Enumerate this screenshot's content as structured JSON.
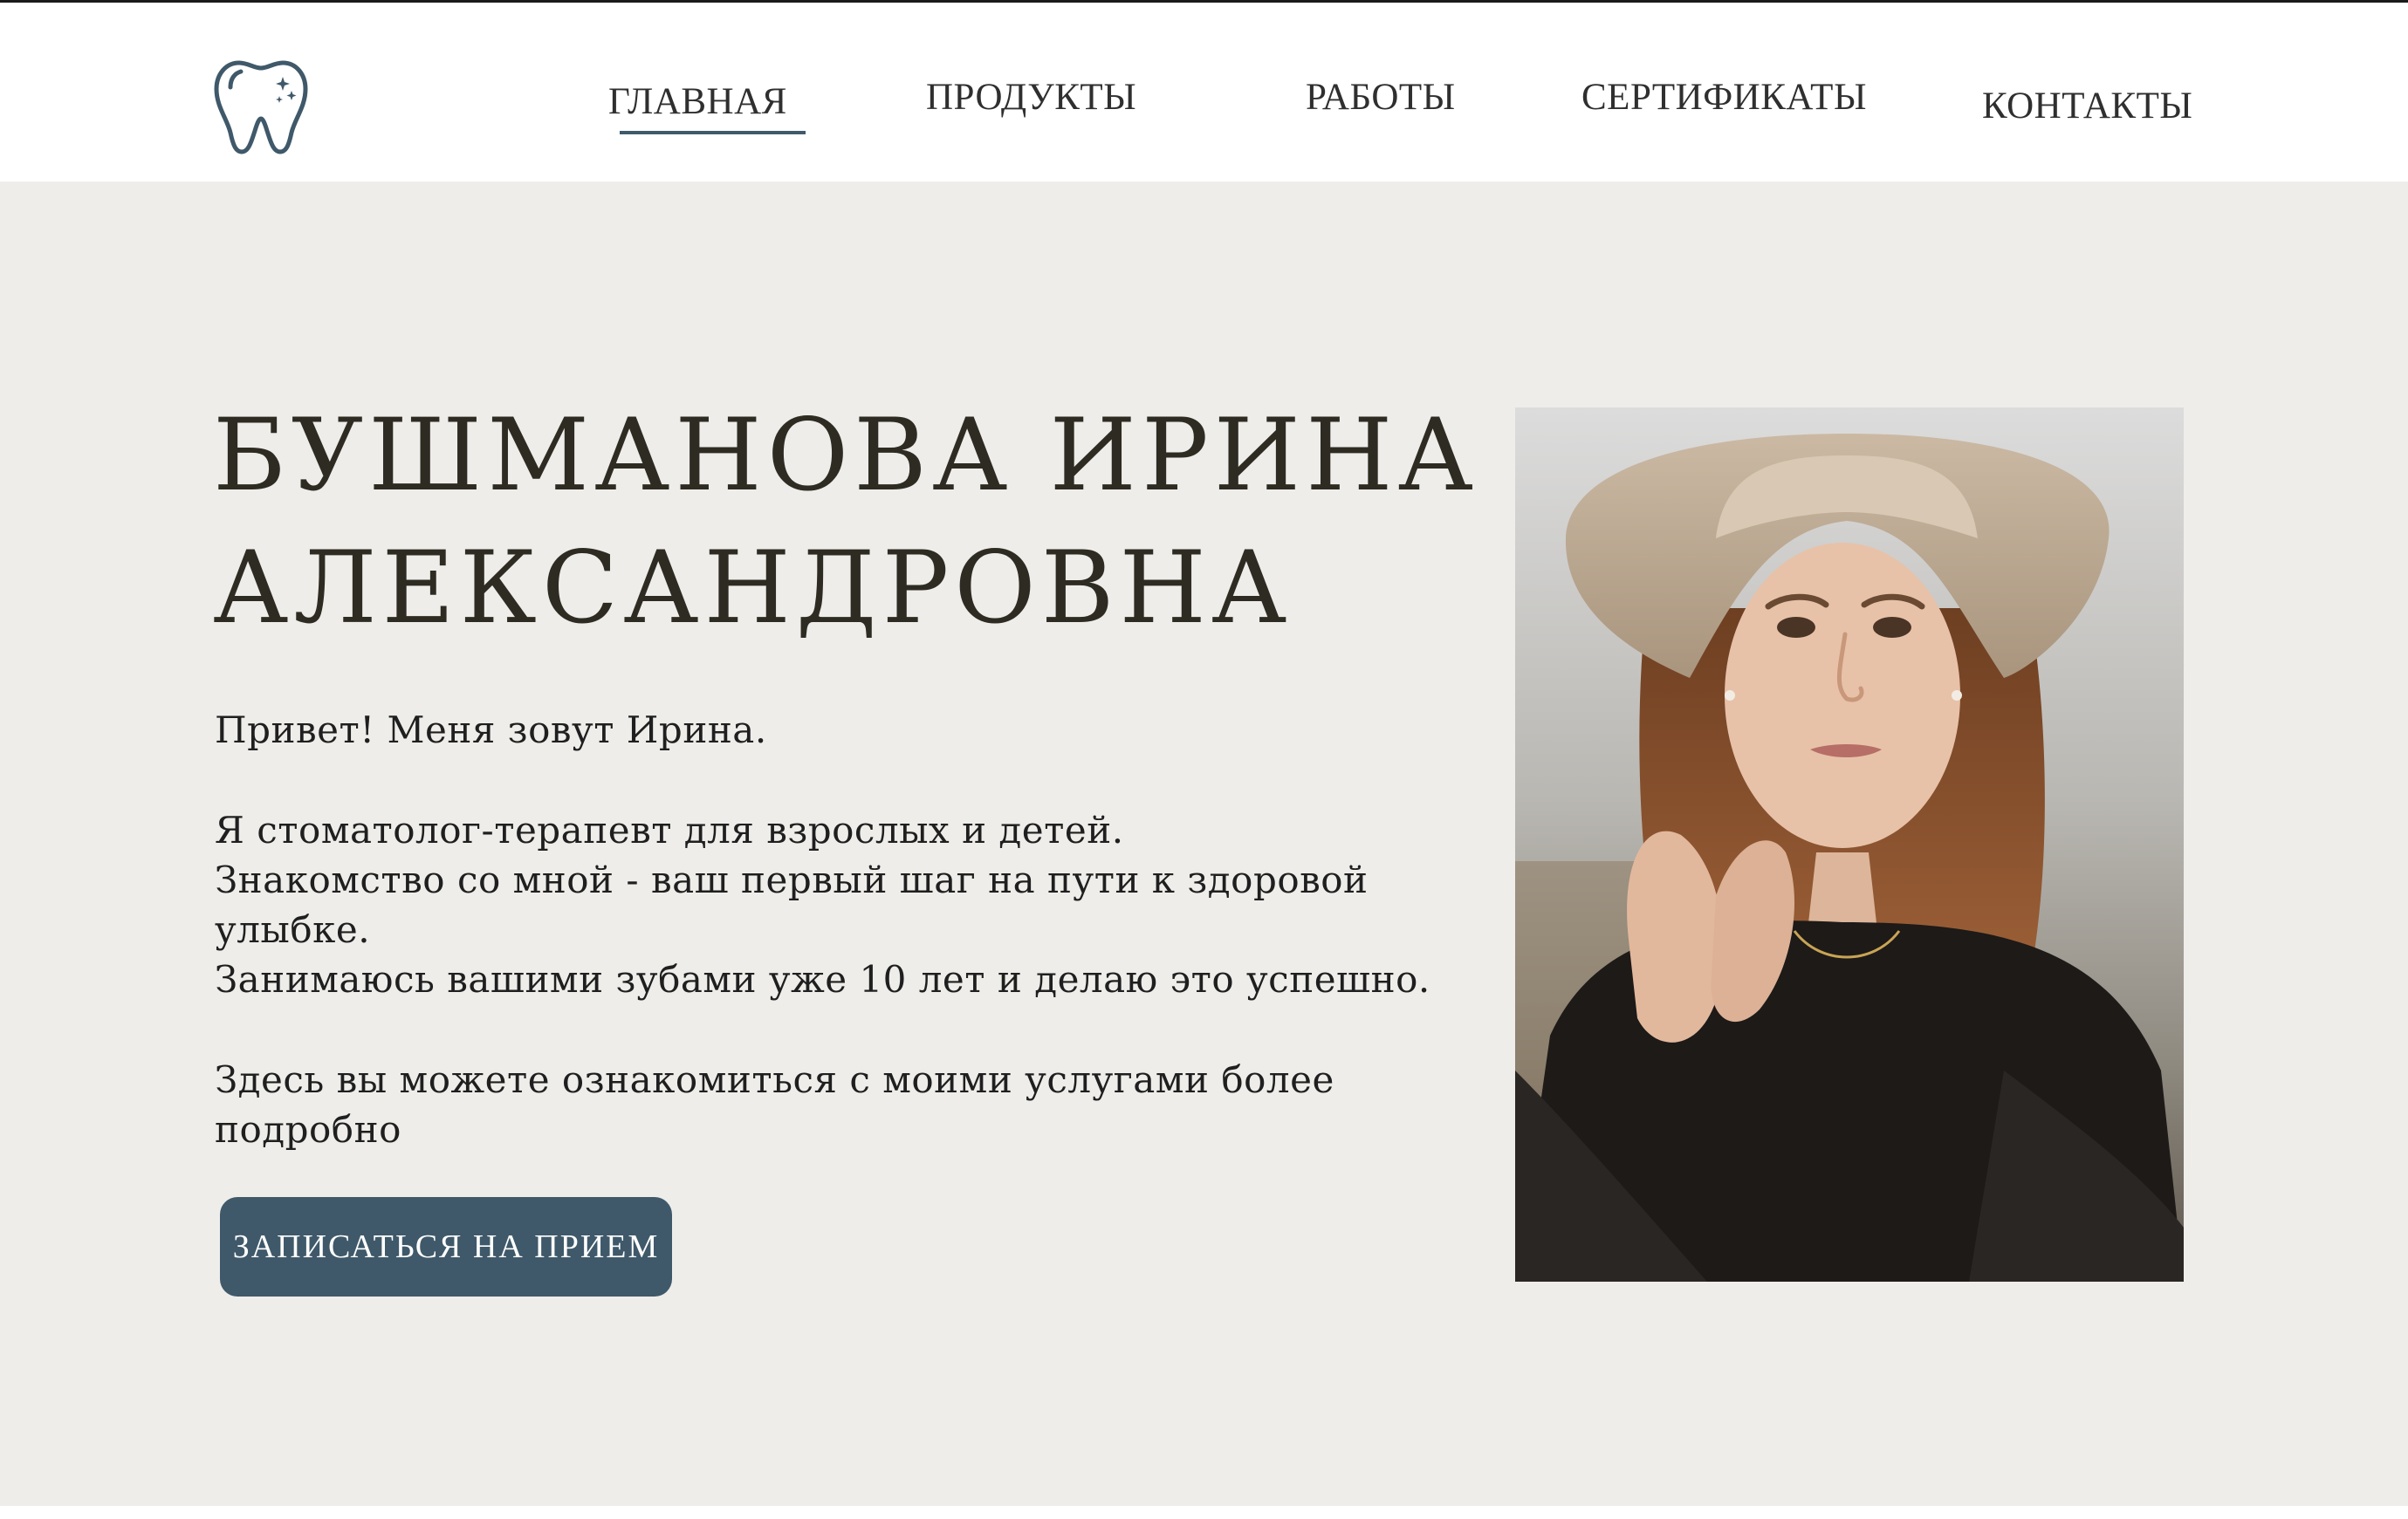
{
  "nav": {
    "items": [
      {
        "label": "ГЛАВНАЯ",
        "active": true
      },
      {
        "label": "ПРОДУКТЫ",
        "active": false
      },
      {
        "label": "РАБОТЫ",
        "active": false
      },
      {
        "label": "СЕРТИФИКАТЫ",
        "active": false
      },
      {
        "label": "КОНТАКТЫ",
        "active": false
      }
    ]
  },
  "logo": {
    "icon": "tooth-icon"
  },
  "hero": {
    "name_line1": "БУШМАНОВА ИРИНА",
    "name_line2": "АЛЕКСАНДРОВНА",
    "greeting": "Привет! Меня зовут Ирина.",
    "about_line1": "Я стоматолог-терапевт для взрослых и детей.",
    "about_line2": "Знакомство со мной - ваш первый шаг на пути к здоровой",
    "about_line3": "улыбке.",
    "about_line4": "Занимаюсь вашими зубами уже 10 лет и делаю это успешно.",
    "services_line1": "Здесь вы можете ознакомиться с моими услугами более",
    "services_line2": "подробно",
    "cta_label": "ЗАПИСАТЬСЯ НА ПРИЕМ"
  },
  "colors": {
    "accent": "#3f596a",
    "hero_bg": "#eeedea",
    "heading": "#2e2c22",
    "text": "#1f1f1f"
  }
}
